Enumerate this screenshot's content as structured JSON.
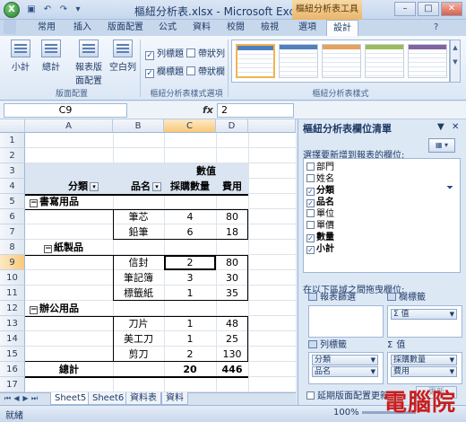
{
  "window": {
    "title": "樞紐分析表.xlsx - Microsoft Excel",
    "context_title": "樞紐分析表工具",
    "min": "–",
    "max": "□",
    "close": "✕"
  },
  "tabs": [
    "常用",
    "插入",
    "版面配置",
    "公式",
    "資料",
    "校閱",
    "檢視",
    "選項",
    "設計"
  ],
  "ribbon": {
    "layout_buttons": [
      "小計",
      "總計",
      "報表版面配置",
      "空白列"
    ],
    "layout_group": "版面配置",
    "checkboxes": [
      {
        "label": "列標題",
        "checked": true
      },
      {
        "label": "帶狀列",
        "checked": false
      },
      {
        "label": "欄標題",
        "checked": true
      },
      {
        "label": "帶狀欄",
        "checked": false
      }
    ],
    "options_group": "樞紐分析表樣式選項",
    "styles_group": "樞紐分析表樣式"
  },
  "formula_bar": {
    "name_box": "C9",
    "fx": "fx",
    "value": "2"
  },
  "columns": [
    "A",
    "B",
    "C",
    "D"
  ],
  "rows": [
    "1",
    "2",
    "3",
    "4",
    "5",
    "6",
    "7",
    "8",
    "9",
    "10",
    "11",
    "12",
    "13",
    "14",
    "15",
    "16",
    "17"
  ],
  "pivot": {
    "values_header": "數值",
    "h_category": "分類",
    "h_item": "品名",
    "h_qty": "採購數量",
    "h_cost": "費用",
    "g1": "書寫用品",
    "g1_items": [
      [
        "筆芯",
        "4",
        "80"
      ],
      [
        "鉛筆",
        "6",
        "18"
      ]
    ],
    "g2": "紙製品",
    "g2_items": [
      [
        "信封",
        "2",
        "80"
      ],
      [
        "筆記簿",
        "3",
        "30"
      ],
      [
        "標籤紙",
        "1",
        "35"
      ]
    ],
    "g3": "辦公用品",
    "g3_items": [
      [
        "刀片",
        "1",
        "48"
      ],
      [
        "美工刀",
        "1",
        "25"
      ],
      [
        "剪刀",
        "2",
        "130"
      ]
    ],
    "total_label": "總計",
    "total_qty": "20",
    "total_cost": "446"
  },
  "sheet_tabs": [
    "Sheet5",
    "Sheet6",
    "資料表",
    "資料"
  ],
  "status": {
    "ready": "就緒",
    "zoom": "100%"
  },
  "pane": {
    "title": "樞紐分析表欄位清單",
    "choose_label": "選擇要新增到報表的欄位:",
    "fields": [
      {
        "name": "部門",
        "checked": false
      },
      {
        "name": "姓名",
        "checked": false
      },
      {
        "name": "分類",
        "checked": true
      },
      {
        "name": "品名",
        "checked": true
      },
      {
        "name": "單位",
        "checked": false
      },
      {
        "name": "單價",
        "checked": false
      },
      {
        "name": "數量",
        "checked": true
      },
      {
        "name": "小計",
        "checked": true
      }
    ],
    "drag_hint": "在以下區域之間拖曳欄位:",
    "report_filter": "報表篩選",
    "column_labels": "欄標籤",
    "row_labels": "列標籤",
    "values": "值",
    "column_chips": [
      "Σ 值"
    ],
    "row_chips": [
      "分類",
      "品名"
    ],
    "value_chips": [
      "採購數量",
      "費用"
    ],
    "defer": "延期版面配置更新",
    "update": "更新"
  },
  "watermark": "電腦院",
  "colors": {
    "accent": "#4f81bd",
    "selection": "#f9c97a",
    "watermark": "#c81e1e"
  }
}
